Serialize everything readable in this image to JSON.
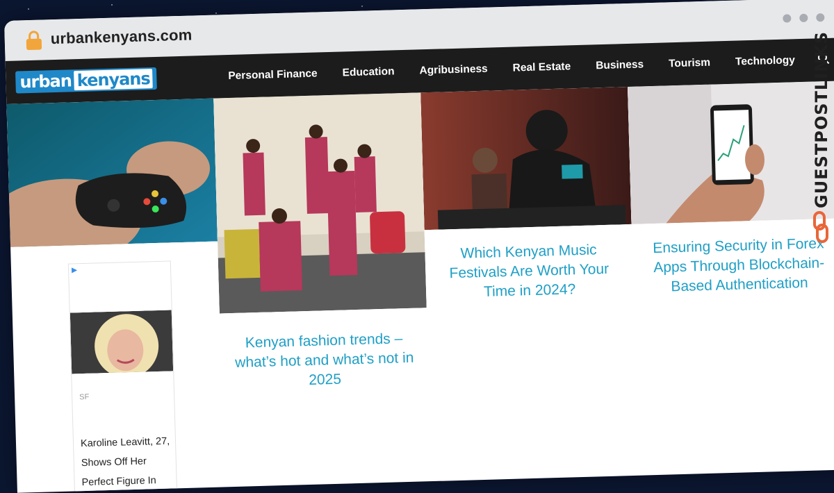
{
  "browser": {
    "url": "urbankenyans.com"
  },
  "site": {
    "logo_part1": "urban",
    "logo_part2": "kenyans",
    "nav_items": [
      "Personal Finance",
      "Education",
      "Agribusiness",
      "Real Estate",
      "Business",
      "Tourism",
      "Technology"
    ]
  },
  "articles": [
    {
      "title": ""
    },
    {
      "title": "Kenyan fashion trends – what’s hot and what’s not in 2025"
    },
    {
      "title": "Which Kenyan Music Festivals Are Worth Your Time in 2024?"
    },
    {
      "title": "Ensuring Security in Forex Apps Through Blockchain-Based Authentication"
    }
  ],
  "ad": {
    "source": "SF",
    "headline": "Karoline Leavitt, 27, Shows Off Her Perfect Figure In"
  },
  "watermark": {
    "text": "GUESTPOSTLINKS"
  },
  "colors": {
    "accent": "#1e9fc6",
    "navbar": "#1c1c1c",
    "logo_blue": "#1f88c8",
    "watermark_orange": "#e8663a"
  }
}
